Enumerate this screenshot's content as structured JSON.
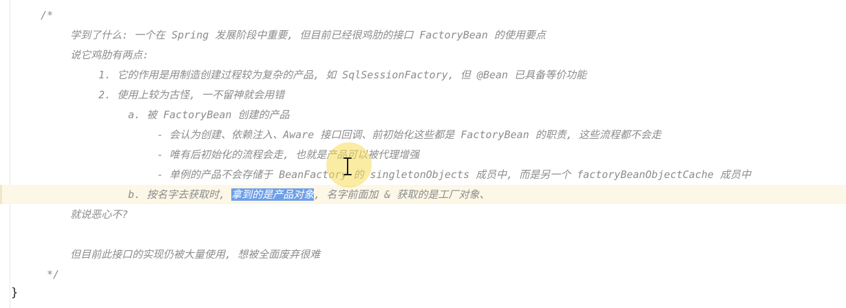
{
  "code": {
    "comment_open": "/*",
    "line_learned": "学到了什么: 一个在 Spring 发展阶段中重要, 但目前已经很鸡肋的接口 FactoryBean 的使用要点",
    "line_two_points": "说它鸡肋有两点:",
    "line_item1": "1. 它的作用是用制造创建过程较为复杂的产品, 如 SqlSessionFactory, 但 @Bean 已具备等价功能",
    "line_item2": "2. 使用上较为古怪, 一不留神就会用错",
    "line_a": "a. 被 FactoryBean 创建的产品",
    "line_a_dash1": "- 会认为创建、依赖注入、Aware 接口回调、前初始化这些都是 FactoryBean 的职责, 这些流程都不会走",
    "line_a_dash2": "- 唯有后初始化的流程会走, 也就是产品可以被代理增强",
    "line_a_dash3": "- 单例的产品不会存储于 BeanFactory 的 singletonObjects 成员中, 而是另一个 factoryBeanObjectCache 成员中",
    "line_b_prefix": "b. 按名字去获取时, ",
    "line_b_selected": "拿到的是产品对象",
    "line_b_suffix": ", 名字前面加 & 获取的是工厂对象、",
    "line_disgusting": "就说恶心不?",
    "line_still_used": "但目前此接口的实现仍被大量使用, 想被全面废弃很难",
    "comment_close": "*/",
    "closing_brace": "}"
  },
  "colors": {
    "comment": "#8c8c8c",
    "selection": "#6e9fe8",
    "current_line": "#fcf7e6",
    "cursor_highlight": "#f8dc5a"
  },
  "icons": {
    "cursor": "text-cursor-ibeam"
  }
}
